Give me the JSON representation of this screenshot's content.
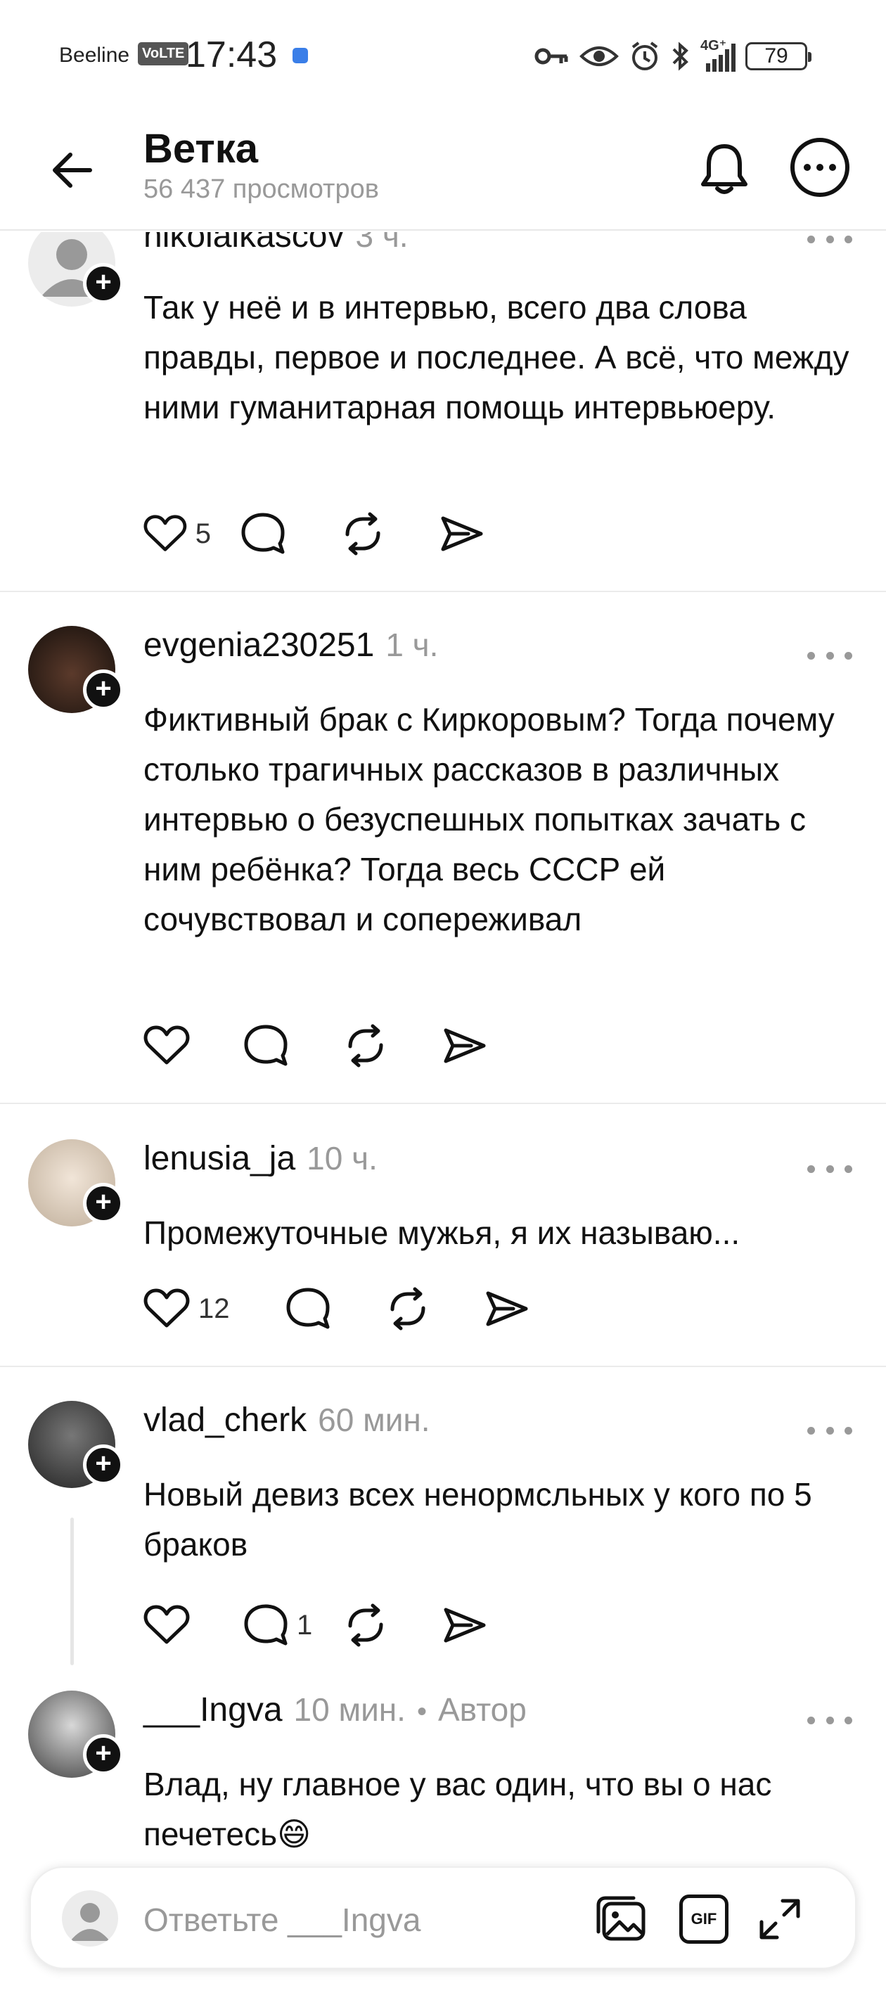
{
  "status_bar": {
    "carrier": "Beeline",
    "volte": "VoLTE",
    "time": "17:43",
    "network": "4G⁺",
    "battery": "79"
  },
  "header": {
    "title": "Ветка",
    "views": "56 437 просмотров"
  },
  "comments": [
    {
      "username": "nikolaikascov",
      "time": "3 ч.",
      "text": "Так у неё и в интервью, всего два слова правды, первое и последнее. А всё, что между ними гуманитарная помощь интервьюеру.",
      "likes": "5",
      "replies": ""
    },
    {
      "username": "evgenia230251",
      "time": "1 ч.",
      "text": "Фиктивный брак с Киркоровым?  Тогда почему столько трагичных  рассказов в различных интервью о безуспешных попытках зачать с ним ребёнка? Тогда весь СССР ей сочувствовал и сопереживал",
      "likes": "",
      "replies": ""
    },
    {
      "username": "lenusia_ja",
      "time": "10 ч.",
      "text": "Промежуточные мужья, я их называю...",
      "likes": "12",
      "replies": ""
    },
    {
      "username": "vlad_cherk",
      "time": "60 мин.",
      "text": "Новый девиз всех ненормсльных у кого по 5 браков",
      "likes": "",
      "replies": "1"
    },
    {
      "username": "___Ingva",
      "time": "10 мин.",
      "separator": "•",
      "badge": "Автор",
      "text": "Влад, ну главное у вас один, что вы о нас печетесь😄"
    }
  ],
  "reply": {
    "placeholder": "Ответьте ___Ingva",
    "gif_label": "GIF"
  },
  "icons": {
    "back": "arrow-left-icon",
    "bell": "bell-icon",
    "more": "more-circle-icon",
    "like": "heart-icon",
    "comment": "speech-bubble-icon",
    "repost": "repost-icon",
    "share": "send-icon",
    "gallery": "gallery-icon",
    "gif": "gif-icon",
    "expand": "expand-icon"
  },
  "colors": {
    "text": "#111111",
    "muted": "#999999",
    "divider": "#ebebeb"
  }
}
